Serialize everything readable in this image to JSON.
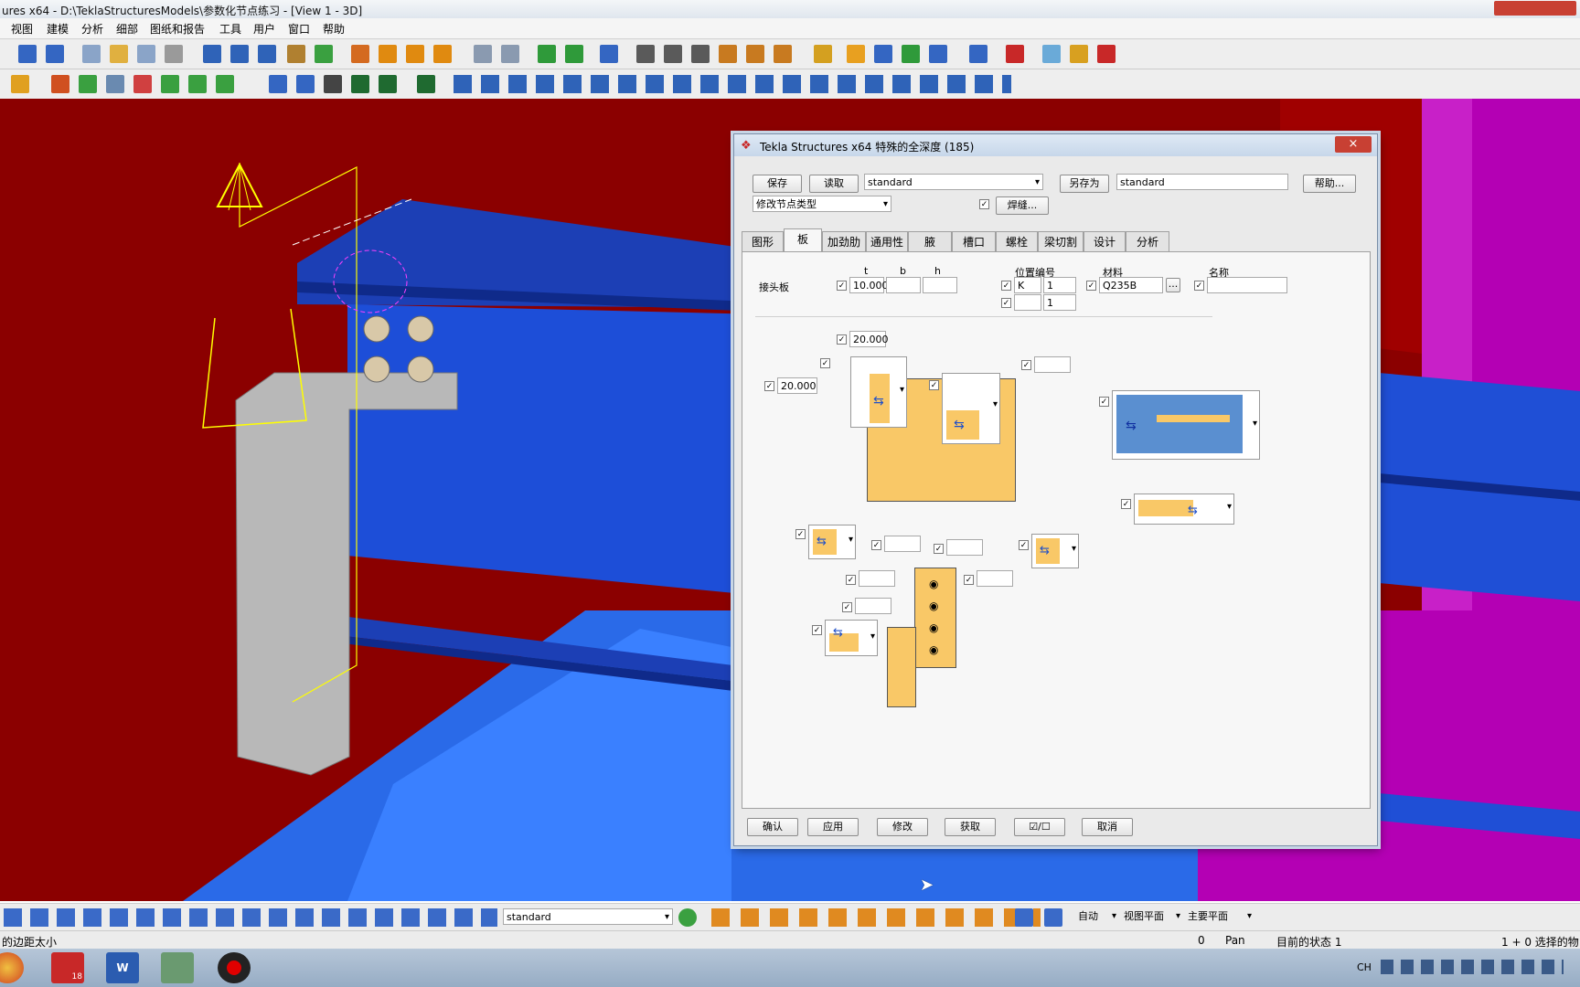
{
  "window": {
    "title": "ures x64 - D:\\TeklaStructuresModels\\参数化节点练习  - [View 1 - 3D]"
  },
  "menu": [
    "视图",
    "建模",
    "分析",
    "细部",
    "图纸和报告",
    "工具",
    "用户",
    "窗口",
    "帮助"
  ],
  "dialog": {
    "title": "Tekla Structures x64  特殊的全深度  (185)",
    "close": "×",
    "save_label": "保存",
    "load_label": "读取",
    "preset_value": "standard",
    "saveas_label": "另存为",
    "saveas_value": "standard",
    "help_label": "帮助...",
    "modify_type": "修改节点类型",
    "weld_label": "焊缝...",
    "tabs": [
      "图形",
      "板",
      "加劲肋",
      "通用性",
      "腋",
      "槽口",
      "螺栓",
      "梁切割",
      "设计",
      "分析"
    ],
    "active_tab": "板",
    "plate": {
      "row_label": "接头板",
      "col_t": "t",
      "col_b": "b",
      "col_h": "h",
      "t_value": "10.000",
      "pos_label": "位置编号",
      "pos_prefix": "K",
      "pos_start": "1",
      "pos_start2": "1",
      "material_label": "材料",
      "material_value": "Q235B",
      "material_btn": "...",
      "name_label": "名称"
    },
    "dims": {
      "top_value": "20.000",
      "left_value": "20.000"
    },
    "footer": {
      "ok": "确认",
      "apply": "应用",
      "modify": "修改",
      "get": "获取",
      "toggle": "☑/☐",
      "cancel": "取消"
    }
  },
  "bottom_toolbar": {
    "standard_value": "standard",
    "snap1": "自动",
    "snap2": "视图平面",
    "snap3": "主要平面"
  },
  "status": {
    "left": "的边距太小",
    "count": "0",
    "mode": "Pan",
    "state": "目前的状态 1",
    "selection": "1 + 0 选择的物"
  },
  "taskbar": {
    "lang": "CH",
    "badge": "18"
  },
  "colors": {
    "column_red": "#8b0000",
    "beam_blue": "#1f4fd6",
    "plate_orange": "#f9c867",
    "magenta": "#b400b4"
  }
}
